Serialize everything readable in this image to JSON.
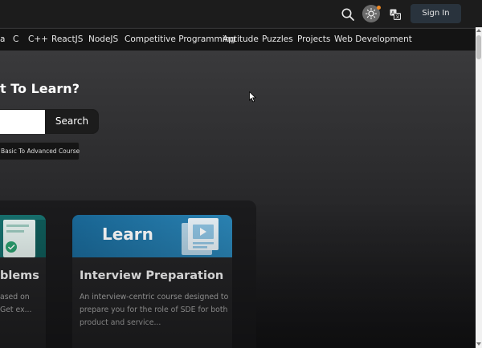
{
  "header": {
    "signin_label": "Sign In"
  },
  "nav": {
    "items": [
      {
        "label": "a"
      },
      {
        "label": "C"
      },
      {
        "label": "C++"
      },
      {
        "label": "ReactJS"
      },
      {
        "label": "NodeJS"
      },
      {
        "label": "Competitive Programming"
      },
      {
        "label": "Aptitude"
      },
      {
        "label": "Puzzles"
      },
      {
        "label": "Projects"
      },
      {
        "label": "Web Development"
      }
    ]
  },
  "hero": {
    "heading": "t To Learn?",
    "search_placeholder": "",
    "search_button": "Search",
    "chip_label": "Basic To Advanced Course"
  },
  "cards": [
    {
      "title": "blems",
      "desc": "ased on Get ex..."
    },
    {
      "banner_text": "Learn",
      "title": "Interview Preparation",
      "desc": "An interview-centric course designed to prepare you for the role of SDE for both product and service..."
    }
  ],
  "colors": {
    "accent": "#1a6a9a",
    "teal": "#17716f",
    "notification_dot": "#f08a24"
  },
  "icons": {
    "search": "search-icon",
    "theme": "sun-icon",
    "translate": "translate-icon"
  }
}
